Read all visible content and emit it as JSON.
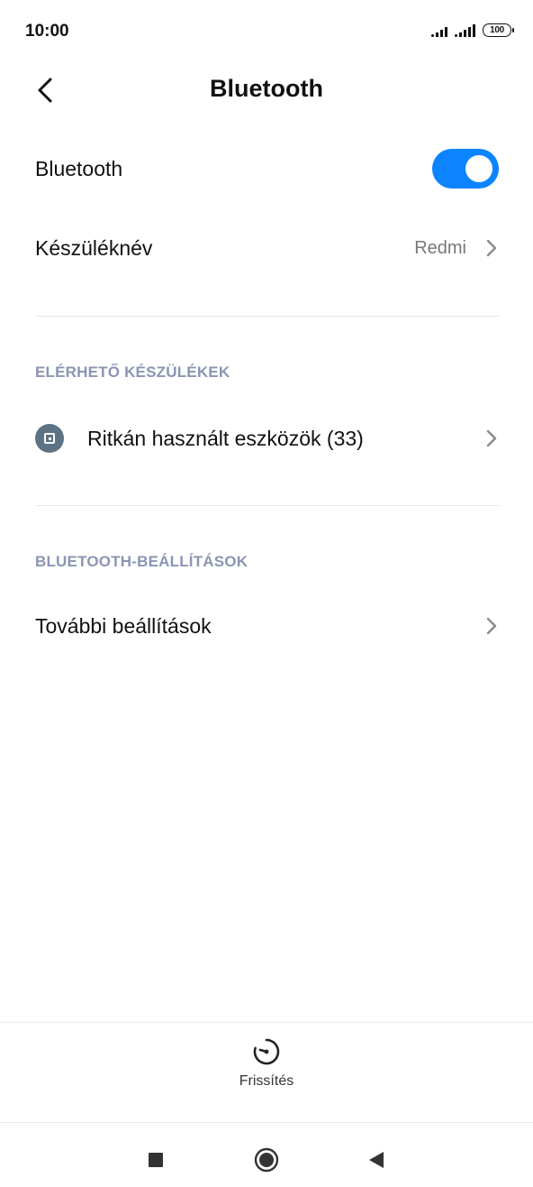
{
  "status_bar": {
    "time": "10:00",
    "battery": "100"
  },
  "header": {
    "title": "Bluetooth"
  },
  "bluetooth_toggle": {
    "label": "Bluetooth",
    "enabled": true,
    "accent_color": "#0d84ff"
  },
  "device_name": {
    "label": "Készüléknév",
    "value": "Redmi"
  },
  "available_devices": {
    "section_title": "ELÉRHETŐ KÉSZÜLÉKEK",
    "items": [
      {
        "label": "Ritkán használt eszközök (33)",
        "icon": "device-icon"
      }
    ]
  },
  "bluetooth_settings": {
    "section_title": "BLUETOOTH-BEÁLLÍTÁSOK",
    "items": [
      {
        "label": "További beállítások"
      }
    ]
  },
  "bottom_action": {
    "label": "Frissítés",
    "icon": "refresh-icon"
  },
  "nav_bar": {
    "icons": [
      "recents-icon",
      "home-icon",
      "back-icon"
    ]
  }
}
